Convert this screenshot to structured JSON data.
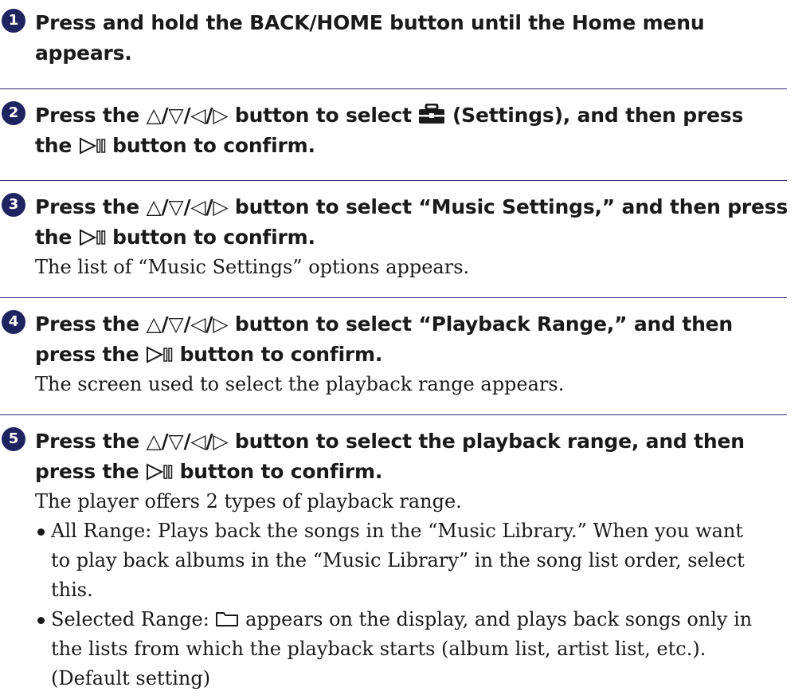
{
  "steps": [
    {
      "number": "1",
      "title_lines": [
        "Press and hold the BACK/HOME button until the Home menu",
        "appears."
      ]
    },
    {
      "number": "2",
      "title_lines": [
        "Press the △/▽/◁/▷ button to select",
        "(Settings), and then press",
        "the",
        "button to confirm."
      ]
    },
    {
      "number": "3",
      "title_lines": [
        "Press the △/▽/◁/▷ button to select “Music Settings,” and then press",
        "the",
        "button to confirm."
      ],
      "body": "The list of “Music Settings” options appears."
    },
    {
      "number": "4",
      "title_lines": [
        "Press the △/▽/◁/▷ button to select “Playback Range,” and then",
        "press the",
        "button to confirm."
      ],
      "body": "The screen used to select the playback range appears."
    },
    {
      "number": "5",
      "title_lines": [
        "Press the △/▽/◁/▷ button to select the playback range, and then",
        "press the",
        "button to confirm."
      ],
      "body": "The player offers 2 types of playback range.",
      "bullets": [
        {
          "lines": [
            "All Range: Plays back the songs in the “Music Library.” When you want",
            "to play back albums in the “Music Library” in the song list order, select",
            "this."
          ]
        },
        {
          "lines": [
            "Selected Range:",
            "appears on the display, and plays back songs only in",
            "the lists from which the playback starts (album list, artist list, etc.).",
            "(Default setting)"
          ]
        }
      ]
    }
  ],
  "icons": {
    "step_number_color": "#1f2360",
    "divider_color": "#2a2f6e",
    "settings_icon": "toolbox-icon",
    "play_pause_icon": "play-pause-icon",
    "folder_icon": "folder-icon"
  }
}
